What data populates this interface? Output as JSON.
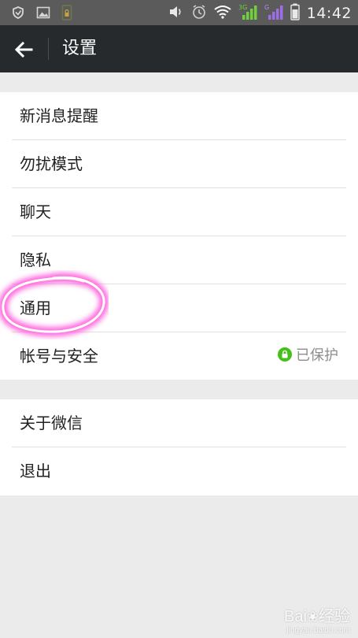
{
  "status_bar": {
    "time": "14:42",
    "icons": [
      "shield-icon",
      "image-icon",
      "phone-lock-icon",
      "volume-icon",
      "alarm-icon",
      "wifi-icon",
      "signal-3g-icon",
      "signal-g-icon",
      "battery-icon"
    ],
    "signal_badges": [
      "3G",
      "G"
    ]
  },
  "header": {
    "title": "设置",
    "back_icon": "back-arrow-icon"
  },
  "settings": {
    "group1": [
      {
        "label": "新消息提醒"
      },
      {
        "label": "勿扰模式"
      },
      {
        "label": "聊天"
      },
      {
        "label": "隐私"
      },
      {
        "label": "通用"
      },
      {
        "label": "帐号与安全",
        "value": "已保护",
        "value_icon": "lock-icon"
      }
    ],
    "group2": [
      {
        "label": "关于微信"
      },
      {
        "label": "退出"
      }
    ]
  },
  "watermark": {
    "brand": "Bai",
    "brand_suffix": "经验",
    "sub": "jingyan.baidu.com"
  },
  "colors": {
    "status_bar": "#5b5b5b",
    "title_bar": "#262a2d",
    "background": "#ebebeb",
    "protect_green": "#45c01a",
    "highlight": "#ff4fd8"
  }
}
